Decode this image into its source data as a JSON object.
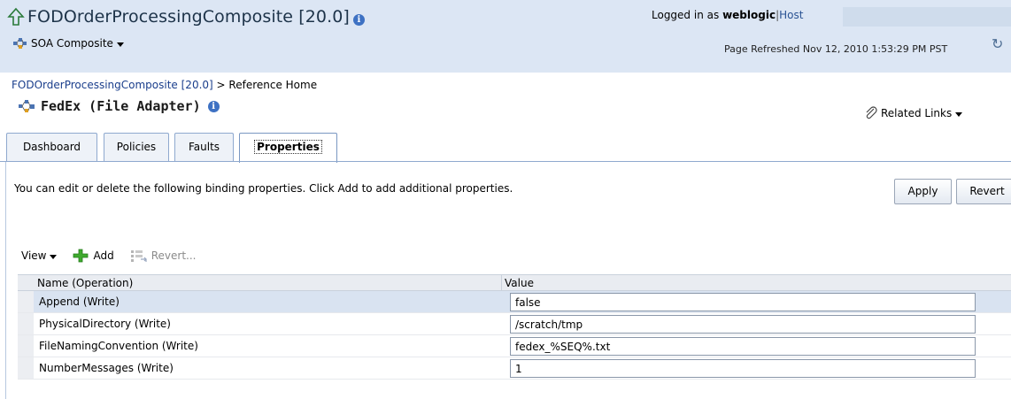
{
  "header": {
    "title": "FODOrderProcessingComposite [20.0]",
    "info_icon": "info-icon",
    "composite_menu": "SOA Composite",
    "logged_in_prefix": "Logged in as",
    "user": "weblogic",
    "host_label": "Host",
    "refreshed": "Page Refreshed Nov 12, 2010 1:53:29 PM PST"
  },
  "breadcrumb": {
    "link": "FODOrderProcessingComposite [20.0]",
    "separator": " > ",
    "current": "Reference Home"
  },
  "reference": {
    "title": "FedEx (File Adapter)",
    "related_links": "Related Links"
  },
  "tabs": [
    {
      "label": "Dashboard",
      "active": false
    },
    {
      "label": "Policies",
      "active": false
    },
    {
      "label": "Faults",
      "active": false
    },
    {
      "label": "Properties",
      "active": true
    }
  ],
  "content": {
    "intro": "You can edit or delete the following binding properties. Click Add to add additional properties.",
    "apply_label": "Apply",
    "revert_label": "Revert"
  },
  "toolbar": {
    "view_label": "View",
    "add_label": "Add",
    "revert_label": "Revert..."
  },
  "table": {
    "columns": [
      "Name (Operation)",
      "Value"
    ],
    "rows": [
      {
        "name": "Append (Write)",
        "value": "false",
        "selected": true
      },
      {
        "name": "PhysicalDirectory (Write)",
        "value": "/scratch/tmp",
        "selected": false
      },
      {
        "name": "FileNamingConvention (Write)",
        "value": "fedex_%SEQ%.txt",
        "selected": false
      },
      {
        "name": "NumberMessages (Write)",
        "value": "1",
        "selected": false
      }
    ]
  },
  "colors": {
    "header_bg": "#dce6f4",
    "link": "#1a3e8c",
    "selected_row": "#d9e3f1"
  }
}
